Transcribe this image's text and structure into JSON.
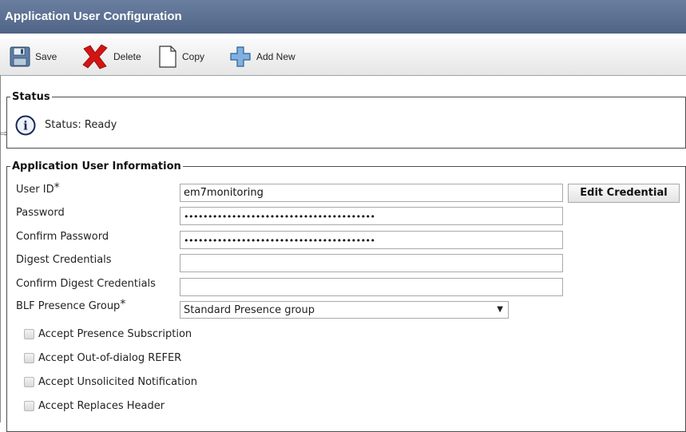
{
  "header": {
    "title": "Application User Configuration"
  },
  "toolbar": {
    "save_label": "Save",
    "delete_label": "Delete",
    "copy_label": "Copy",
    "add_new_label": "Add New"
  },
  "status": {
    "legend": "Status",
    "text": "Status: Ready",
    "icon": "info-icon"
  },
  "info": {
    "legend": "Application User Information",
    "user_id": {
      "label": "User ID",
      "required": "*",
      "value": "em7monitoring"
    },
    "edit_credential_label": "Edit Credential",
    "password": {
      "label": "Password",
      "value": "••••••••••••••••••••••••••••••••••••••••"
    },
    "confirm_password": {
      "label": "Confirm Password",
      "value": "••••••••••••••••••••••••••••••••••••••••"
    },
    "digest": {
      "label": "Digest Credentials",
      "value": ""
    },
    "confirm_digest": {
      "label": "Confirm Digest Credentials",
      "value": ""
    },
    "blf": {
      "label": "BLF Presence Group",
      "required": "*",
      "value": "Standard Presence group"
    },
    "checkboxes": [
      {
        "label": "Accept Presence Subscription",
        "checked": false
      },
      {
        "label": "Accept Out-of-dialog REFER",
        "checked": false
      },
      {
        "label": "Accept Unsolicited Notification",
        "checked": false
      },
      {
        "label": "Accept Replaces Header",
        "checked": false
      }
    ]
  },
  "colors": {
    "titlebar": "#5a6f8f",
    "delete_red": "#d21414",
    "add_blue": "#4a86c8"
  }
}
